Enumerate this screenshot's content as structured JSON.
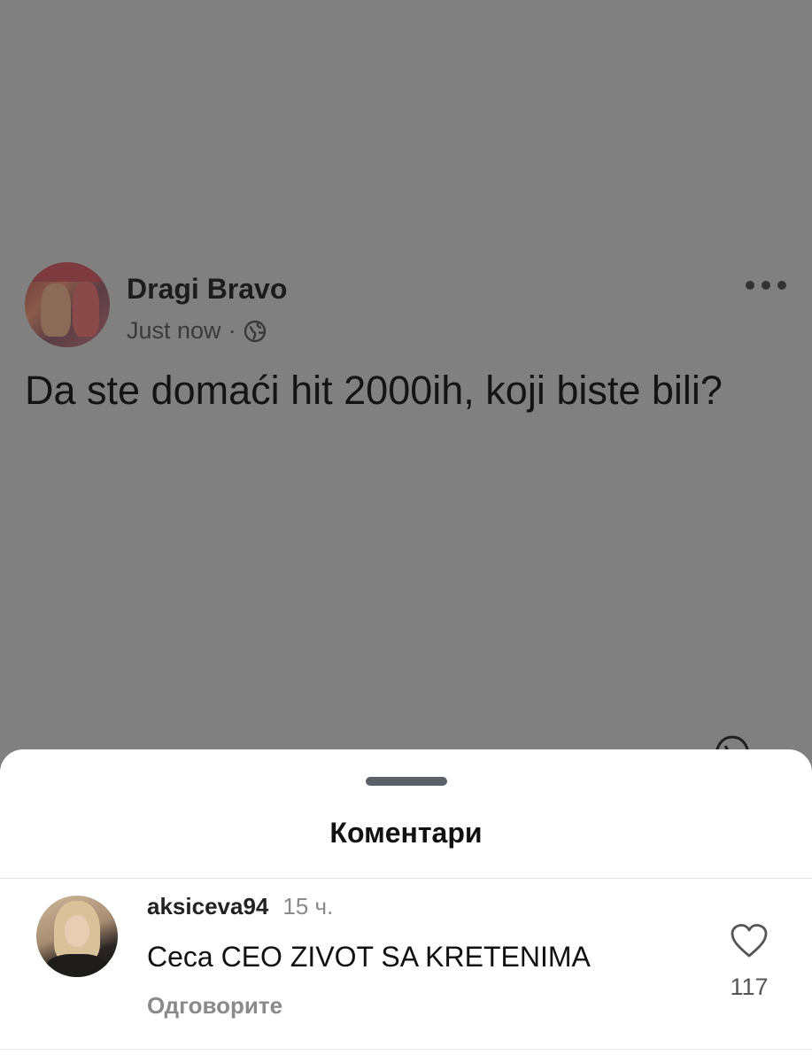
{
  "post": {
    "author": "Dragi Bravo",
    "time": "Just now",
    "separator": "·",
    "privacy_icon": "globe-icon",
    "more_icon": "more-dots-icon",
    "text": "Da ste domaći hit 2000ih, koji biste bili?"
  },
  "comments_sheet": {
    "title": "Коментари",
    "comments": [
      {
        "username": "aksiceva94",
        "time": "15 ч.",
        "text": "Ceca CEO ZIVOT SA KRETENIMA",
        "reply_label": "Одговорите",
        "likes": "117",
        "like_icon": "heart-icon"
      }
    ]
  },
  "colors": {
    "overlay": "#808080",
    "sheet": "#ffffff",
    "muted_text": "#8a8a8a"
  }
}
